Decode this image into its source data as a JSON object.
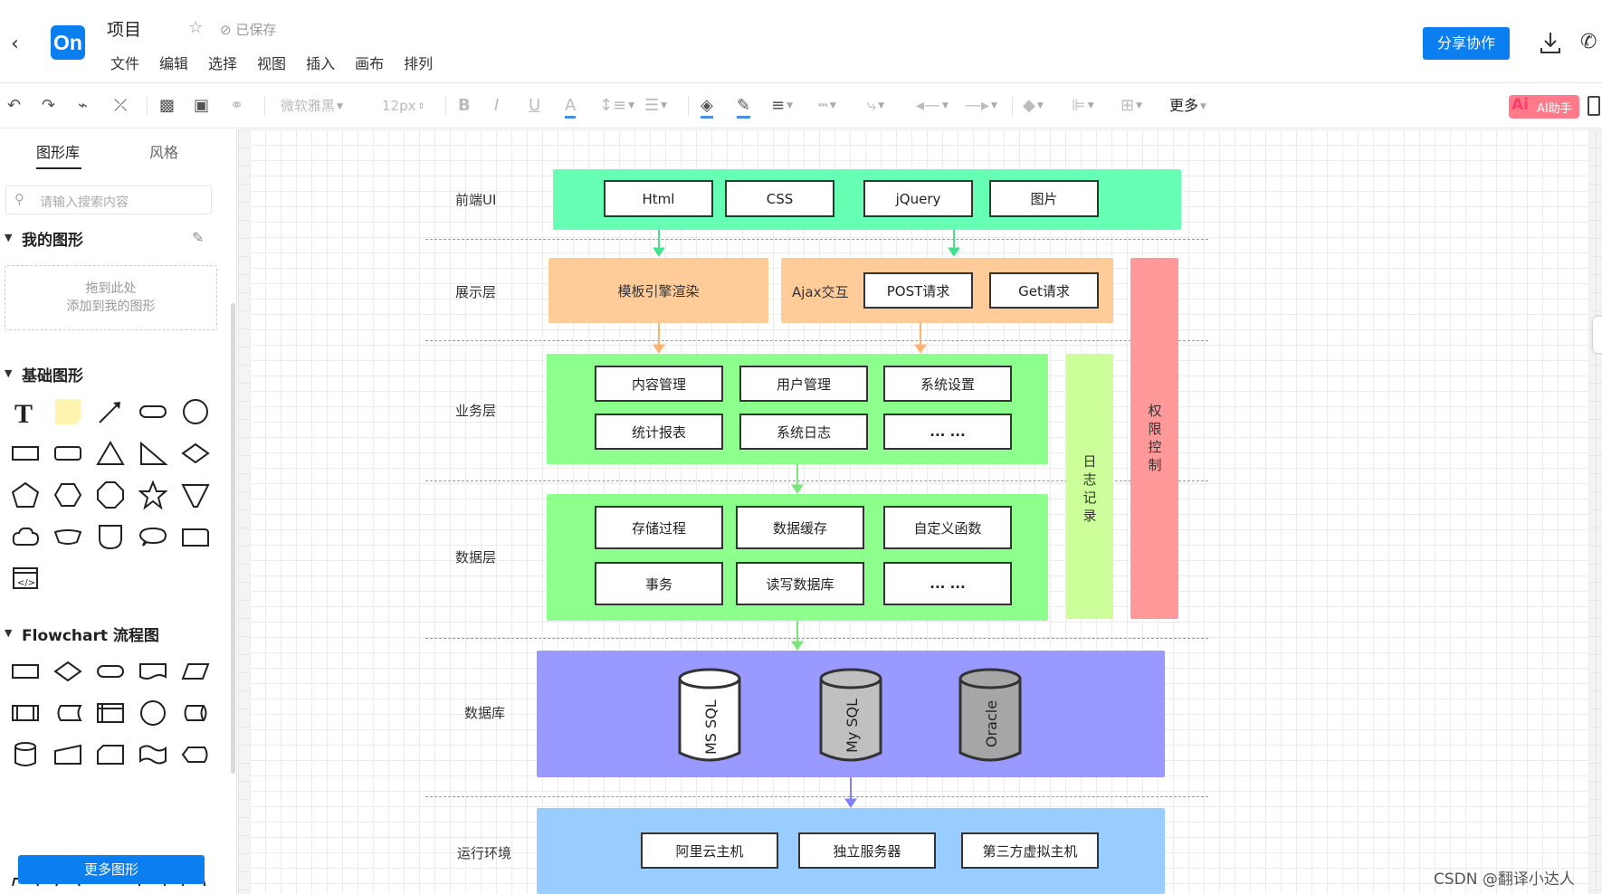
{
  "app": {
    "logo_text": "On",
    "title": "项目",
    "saved_status": "已保存",
    "menu": [
      "文件",
      "编辑",
      "选择",
      "视图",
      "插入",
      "画布",
      "排列"
    ],
    "share_label": "分享协作"
  },
  "toolbar": {
    "font_name": "微软雅黑",
    "font_size": "12px",
    "more_label": "更多",
    "ai_mark": "Ai",
    "ai_label": "AI助手"
  },
  "sidebar": {
    "tabs": [
      "图形库",
      "风格"
    ],
    "search_placeholder": "请输入搜索内容",
    "my_shapes_title": "我的图形",
    "drop_hint_line1": "拖到此处",
    "drop_hint_line2": "添加到我的图形",
    "basic_title": "基础图形",
    "flowchart_title": "Flowchart 流程图",
    "more_shapes_label": "更多图形"
  },
  "diagram": {
    "row_labels": {
      "frontend": "前端UI",
      "presentation": "展示层",
      "business": "业务层",
      "data": "数据层",
      "database": "数据库",
      "runtime": "运行环境"
    },
    "frontend_items": [
      "Html",
      "CSS",
      "jQuery",
      "图片"
    ],
    "presentation": {
      "template": "模板引擎渲染",
      "ajax": "Ajax交互",
      "post": "POST请求",
      "get": "Get请求"
    },
    "business_items": [
      "内容管理",
      "用户管理",
      "系统设置",
      "统计报表",
      "系统日志",
      "... ..."
    ],
    "data_items": [
      "存储过程",
      "数据缓存",
      "自定义函数",
      "事务",
      "读写数据库",
      "... ..."
    ],
    "log_label": "日志记录",
    "auth_label": "权限控制",
    "databases": [
      "MS SQL",
      "My SQL",
      "Oracle"
    ],
    "runtime_items": [
      "阿里云主机",
      "独立服务器",
      "第三方虚拟主机"
    ],
    "colors": {
      "frontend": "#66ffb3",
      "presentation": "#ffcc99",
      "business": "#8cff8c",
      "log": "#ccff99",
      "auth": "#ff9999",
      "database": "#9999ff",
      "runtime": "#99ccff"
    }
  },
  "watermark": "CSDN @翻译小达人"
}
